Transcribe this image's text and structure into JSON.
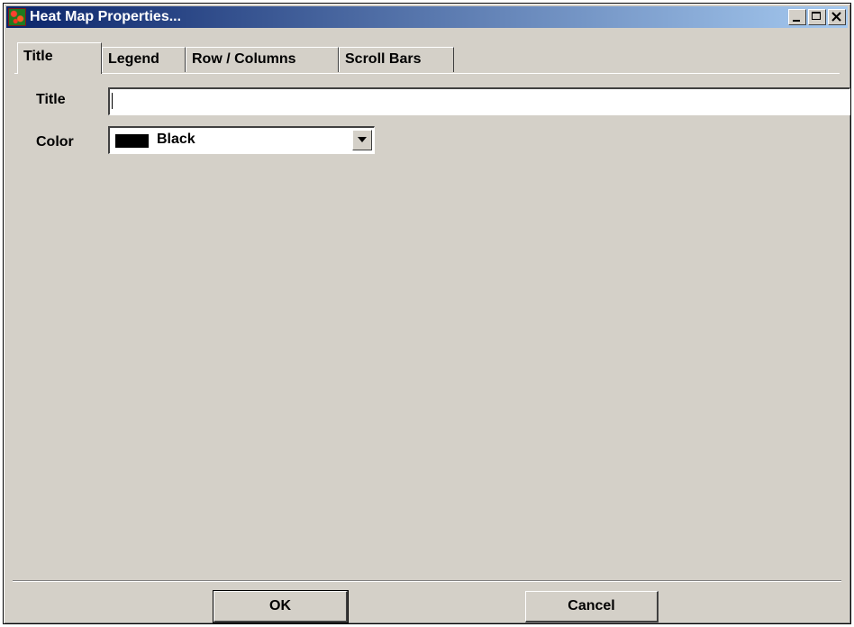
{
  "window": {
    "title": "Heat Map Properties...",
    "app_icon": "heatmap-app-icon",
    "controls": [
      "minimize",
      "maximize",
      "close"
    ]
  },
  "tabs": [
    {
      "label": "Title",
      "active": true
    },
    {
      "label": "Legend",
      "active": false
    },
    {
      "label": "Row / Columns",
      "active": false
    },
    {
      "label": "Scroll Bars",
      "active": false
    }
  ],
  "form": {
    "title_label": "Title",
    "title_value": "",
    "color_label": "Color",
    "color_value": "Black",
    "color_swatch": "#000000"
  },
  "buttons": {
    "ok": "OK",
    "cancel": "Cancel"
  }
}
